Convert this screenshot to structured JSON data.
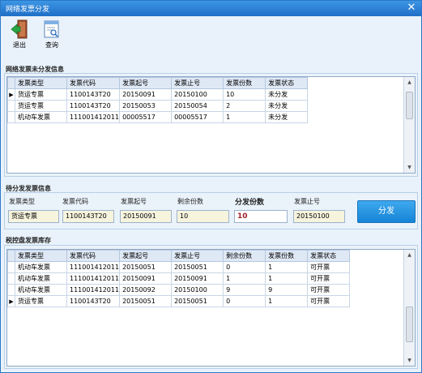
{
  "window": {
    "title": "网络发票分发"
  },
  "toolbar": {
    "exit_label": "退出",
    "query_label": "查询"
  },
  "undistributed": {
    "title": "网络发票未分发信息",
    "columns": [
      "发票类型",
      "发票代码",
      "发票起号",
      "发票止号",
      "发票份数",
      "发票状态"
    ],
    "rows": [
      [
        "货运专票",
        "1100143T20",
        "20150091",
        "20150100",
        "10",
        "未分发"
      ],
      [
        "货运专票",
        "1100143T20",
        "20150053",
        "20150054",
        "2",
        "未分发"
      ],
      [
        "机动车发票",
        "111001412011",
        "00005517",
        "00005517",
        "1",
        "未分发"
      ]
    ],
    "selected_row": 0
  },
  "pending": {
    "title": "待分发发票信息",
    "labels": {
      "type": "发票类型",
      "code": "发票代码",
      "start": "发票起号",
      "remaining": "剩余份数",
      "count": "分发份数",
      "end": "发票止号"
    },
    "values": {
      "type": "货运专票",
      "code": "1100143T20",
      "start": "20150091",
      "remaining": "10",
      "count": "10",
      "end": "20150100"
    },
    "distribute_label": "分发"
  },
  "inventory": {
    "title": "税控盘发票库存",
    "columns": [
      "发票类型",
      "发票代码",
      "发票起号",
      "发票止号",
      "剩余份数",
      "发票份数",
      "发票状态"
    ],
    "rows": [
      [
        "机动车发票",
        "111001412011",
        "20150051",
        "20150051",
        "0",
        "1",
        "可开票"
      ],
      [
        "机动车发票",
        "111001412011",
        "20150091",
        "20150091",
        "1",
        "1",
        "可开票"
      ],
      [
        "机动车发票",
        "111001412011",
        "20150092",
        "20150100",
        "9",
        "9",
        "可开票"
      ],
      [
        "货运专票",
        "1100143T20",
        "20150051",
        "20150051",
        "0",
        "1",
        "可开票"
      ]
    ],
    "selected_row": 3
  },
  "colors": {
    "titlebar": "#2a82d8",
    "accent_button": "#1e8fe0",
    "readonly_field": "#f7f4de"
  }
}
